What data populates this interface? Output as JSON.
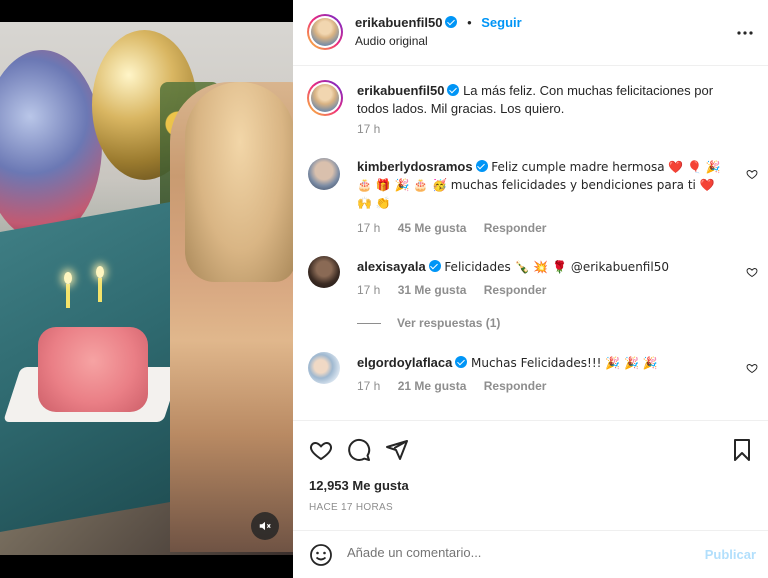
{
  "header": {
    "username": "erikabuenfil50",
    "separator": "•",
    "follow_label": "Seguir",
    "audio_label": "Audio original",
    "more_icon": "more-horizontal-icon"
  },
  "caption": {
    "username": "erikabuenfil50",
    "text": "La más feliz. Con muchas felicitaciones por todos lados. Mil gracias. Los quiero.",
    "time": "17 h"
  },
  "comments": [
    {
      "username": "kimberlydosramos",
      "text_line1": "Feliz cumple madre hermosa ❤️ 🎈 🎉",
      "text_line2": "🎂 🎁 🎉 🎂 🥳 muchas felicidades y bendiciones para ti ❤️",
      "text_line3": "🙌 👏",
      "time": "17 h",
      "likes": "45 Me gusta",
      "reply": "Responder"
    },
    {
      "username": "alexisayala",
      "text": "Felicidades 🍾 💥 🌹 @erikabuenfil50",
      "time": "17 h",
      "likes": "31 Me gusta",
      "reply": "Responder",
      "view_replies": "Ver respuestas (1)"
    },
    {
      "username": "elgordoylaflaca",
      "text": "Muchas Felicidades!!! 🎉 🎉 🎉",
      "time": "17 h",
      "likes": "21 Me gusta",
      "reply": "Responder"
    }
  ],
  "actions": {
    "likes": "12,953 Me gusta",
    "time_ago": "HACE 17 HORAS"
  },
  "add_comment": {
    "placeholder": "Añade un comentario...",
    "publish": "Publicar"
  },
  "colors": {
    "accent": "#0095f6",
    "publish_disabled": "#b2dffc",
    "muted": "#8e8e8e",
    "like_heart": "#ed4956"
  }
}
